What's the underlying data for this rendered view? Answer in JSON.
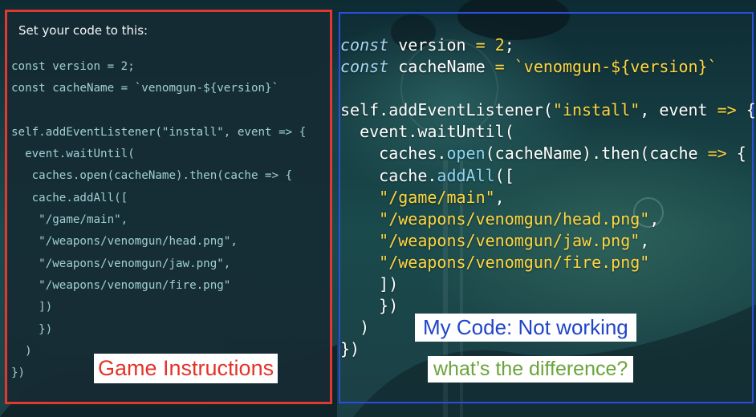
{
  "left_panel": {
    "header": "Set your code to this:",
    "code": [
      "const version = 2;",
      "const cacheName = `venomgun-${version}`",
      "",
      "self.addEventListener(\"install\", event => {",
      "  event.waitUntil(",
      "   caches.open(cacheName).then(cache => {",
      "   cache.addAll([",
      "    \"/game/main\",",
      "    \"/weapons/venomgun/head.png\",",
      "    \"/weapons/venomgun/jaw.png\",",
      "    \"/weapons/venomgun/fire.png\"",
      "    ])",
      "    })",
      "  )",
      "})"
    ],
    "label": "Game Instructions"
  },
  "right_panel": {
    "code": [
      "const version = 2;",
      "const cacheName = `venomgun-${version}`",
      "",
      "self.addEventListener(\"install\", event => {",
      "  event.waitUntil(",
      "    caches.open(cacheName).then(cache => {",
      "    cache.addAll([",
      "    \"/game/main\",",
      "    \"/weapons/venomgun/head.png\",",
      "    \"/weapons/venomgun/jaw.png\",",
      "    \"/weapons/venomgun/fire.png\"",
      "    ])",
      "    })",
      "  )",
      "})"
    ],
    "label_status": "My Code: Not working",
    "label_question": "what’s the difference?"
  },
  "colors": {
    "left_border": "#e2382f",
    "right_border": "#2a4fe0",
    "label_red": "#e3342a",
    "label_blue": "#1f45c8",
    "label_green": "#6ba43b",
    "string_yellow": "#ffd640"
  }
}
